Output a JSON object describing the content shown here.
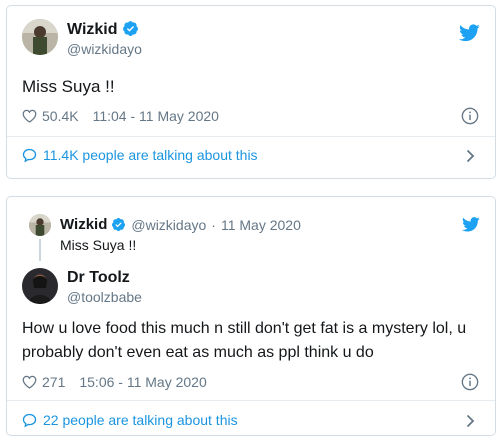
{
  "colors": {
    "link": "#1b95e0",
    "muted": "#657786",
    "text": "#14171a",
    "brand": "#1da1f2"
  },
  "tweet1": {
    "author_name": "Wizkid",
    "author_handle": "@wizkidayo",
    "text": "Miss Suya !!",
    "likes": "50.4K",
    "timestamp": "11:04 - 11 May 2020",
    "talking": "11.4K people are talking about this"
  },
  "tweet2": {
    "quoted": {
      "author_name": "Wizkid",
      "author_handle": "@wizkidayo",
      "separator": "·",
      "date": "11 May 2020",
      "text": "Miss Suya !!"
    },
    "author_name": "Dr Toolz",
    "author_handle": "@toolzbabe",
    "text": "How u love food this much n still don't get fat is a mystery lol, u probably don't even eat as much as ppl think u do",
    "likes": "271",
    "timestamp": "15:06 - 11 May 2020",
    "talking": "22 people are talking about this"
  },
  "icons": [
    "verified-icon",
    "twitter-bird-icon",
    "heart-icon",
    "info-icon",
    "speech-bubble-icon",
    "chevron-right-icon"
  ]
}
